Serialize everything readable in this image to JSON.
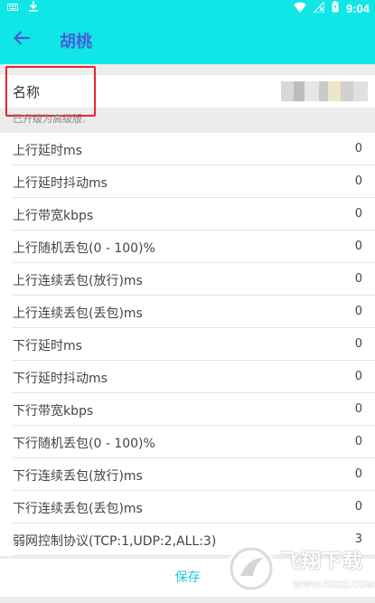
{
  "status_bar": {
    "time": "9:04"
  },
  "app_bar": {
    "title": "胡桃"
  },
  "name_field": {
    "label": "名称",
    "blurred_value_colors": [
      "#d8d8d8",
      "#bdbdbd",
      "#e6e6e6",
      "#c9c9c9",
      "#ece6c8",
      "#d0d0d0",
      "#e0e0e0"
    ]
  },
  "hint": "已升级为高级版.",
  "settings": [
    {
      "label": "上行延时ms",
      "value": "0"
    },
    {
      "label": "上行延时抖动ms",
      "value": "0"
    },
    {
      "label": "上行带宽kbps",
      "value": "0"
    },
    {
      "label": "上行随机丢包(0 - 100)%",
      "value": "0"
    },
    {
      "label": "上行连续丢包(放行)ms",
      "value": "0"
    },
    {
      "label": "上行连续丢包(丢包)ms",
      "value": "0"
    },
    {
      "label": "下行延时ms",
      "value": "0"
    },
    {
      "label": "下行延时抖动ms",
      "value": "0"
    },
    {
      "label": "下行带宽kbps",
      "value": "0"
    },
    {
      "label": "下行随机丢包(0 - 100)%",
      "value": "0"
    },
    {
      "label": "下行连续丢包(放行)ms",
      "value": "0"
    },
    {
      "label": "下行连续丢包(丢包)ms",
      "value": "0"
    },
    {
      "label": "弱网控制协议(TCP:1,UDP:2,ALL:3)",
      "value": "3"
    }
  ],
  "save_label": "保存",
  "watermark": {
    "text": "飞翔下载",
    "url": "WWW.FXXZ.COM"
  },
  "colors": {
    "accent": "#10e6e6",
    "title": "#4a5bd8",
    "highlight": "#e8242e",
    "save": "#25c7e6"
  }
}
